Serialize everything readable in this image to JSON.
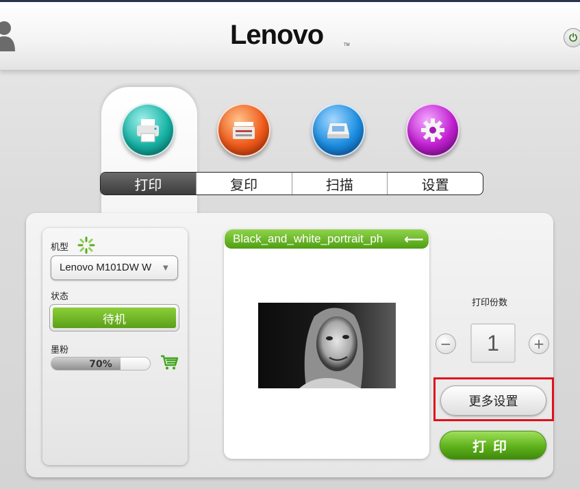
{
  "header": {
    "brand": "Lenovo",
    "brand_mark": "TM"
  },
  "icons": {
    "user": "user-icon",
    "power": "power-icon",
    "printer": "printer-icon",
    "copier": "copier-icon",
    "scanner": "scanner-icon",
    "settings": "gear-icon",
    "refresh": "spinner-icon",
    "cart": "cart-icon",
    "back": "back-arrow-icon"
  },
  "tabs": [
    {
      "label": "打印",
      "active": true
    },
    {
      "label": "复印",
      "active": false
    },
    {
      "label": "扫描",
      "active": false
    },
    {
      "label": "设置",
      "active": false
    }
  ],
  "left_panel": {
    "model_label": "机型",
    "model_value": "Lenovo M101DW W",
    "status_label": "状态",
    "status_value": "待机",
    "toner_label": "墨粉",
    "toner_percent": "70%",
    "toner_level": 0.7
  },
  "preview": {
    "file_name": "Black_and_white_portrait_ph",
    "back_arrow": "⟵"
  },
  "copies": {
    "label": "打印份数",
    "value": "1",
    "minus": "−",
    "plus": "+"
  },
  "actions": {
    "more_settings": "更多设置",
    "print": "打印"
  },
  "colors": {
    "accent_green": "#5fb11c",
    "highlight_red": "#e0101a",
    "active_tab": "#3c3c3c"
  }
}
